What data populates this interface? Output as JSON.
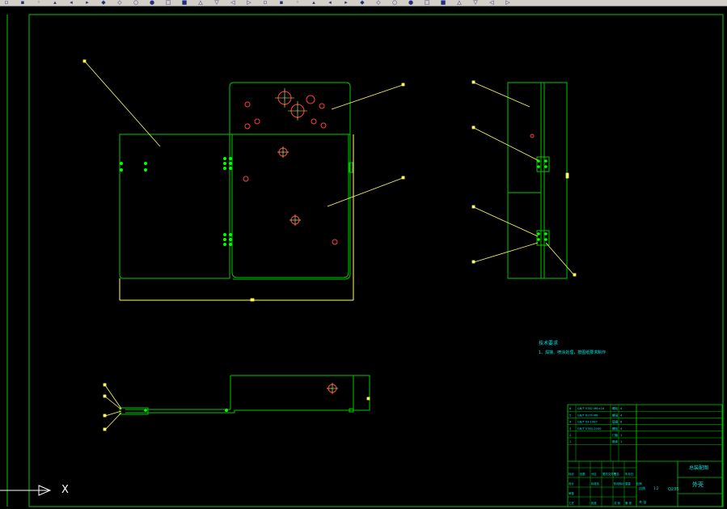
{
  "app": {
    "name": "CAD drawing viewport"
  },
  "toolbar": {
    "icons": [
      "new-icon",
      "open-icon",
      "save-icon",
      "print-icon",
      "undo-icon",
      "redo-icon",
      "pan-icon",
      "zoom-icon",
      "properties-icon",
      "layer-icon",
      "match-icon",
      "line-icon",
      "polyline-icon",
      "circle-icon",
      "arc-icon",
      "hatch-icon",
      "text-icon",
      "dimension-icon",
      "block-icon",
      "insert-icon",
      "copy-icon",
      "mirror-icon",
      "offset-icon",
      "array-icon",
      "move-icon",
      "rotate-icon",
      "scale-icon",
      "trim-icon",
      "extend-icon",
      "fillet-icon",
      "explode-icon",
      "help-icon"
    ]
  },
  "colors": {
    "background": "#000000",
    "frame": "#00c800",
    "leader": "#ffff66",
    "hole": "#ff4040",
    "text_cyan": "#00e5e5",
    "toolbar": "#d4d0c8"
  },
  "ucs": {
    "x_label": "X"
  },
  "notes": {
    "title": "技术要求",
    "line1": "1、焊接、喷涂处理，按图纸要求制作"
  },
  "title_block": {
    "drawing_name": "总装配图",
    "part_name": "外壳",
    "scale_label": "比例",
    "scale_value": "1:2",
    "sheet_label": "共 张",
    "material": "Q235",
    "rows": [
      [
        "6",
        "GB/T 5782 M6×16",
        "螺栓",
        "4"
      ],
      [
        "5",
        "GB/T 6170 M6",
        "螺母",
        "4"
      ],
      [
        "4",
        "GB/T 93-1987",
        "垫圈",
        "8"
      ],
      [
        "3",
        "GB/T 5780-2000",
        "螺栓",
        "4"
      ],
      [
        "2",
        "",
        "门板",
        "1"
      ],
      [
        "1",
        "",
        "箱体",
        "1"
      ]
    ],
    "footer": [
      "标记",
      "处数",
      "分区",
      "更改文件号",
      "签名",
      "年月日"
    ],
    "footer2": [
      "设计",
      "",
      "标准化",
      "",
      "阶段标记",
      "重量",
      "比例"
    ],
    "footer3": [
      "审核",
      "",
      "",
      "",
      "",
      "",
      ""
    ],
    "footer4": [
      "工艺",
      "",
      "批准",
      "",
      "共 张",
      "第 张"
    ]
  }
}
